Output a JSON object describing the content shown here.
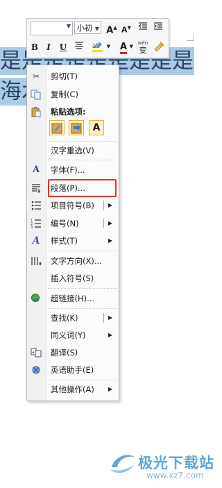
{
  "document": {
    "line1": "是是是是是是是是是",
    "line2": "海水"
  },
  "mini_toolbar": {
    "font_name": "",
    "font_size": "小初",
    "grow_font_label": "A",
    "shrink_font_label": "A",
    "bold_label": "B",
    "italic_label": "I",
    "underline_label": "U",
    "font_color_label": "A",
    "phonetic_label": "wén",
    "phonetic_char": "变"
  },
  "context_menu": {
    "items": [
      {
        "label": "剪切(T)",
        "icon": "scissors-icon"
      },
      {
        "label": "复制(C)",
        "icon": "copy-icon"
      },
      {
        "label": "粘贴选项:",
        "icon": "clipboard-icon"
      },
      {
        "label": "汉字重选(V)",
        "icon": ""
      },
      {
        "label": "字体(F)...",
        "icon": "font-icon"
      },
      {
        "label": "段落(P)...",
        "icon": "paragraph-icon"
      },
      {
        "label": "项目符号(B)",
        "icon": "bullets-icon"
      },
      {
        "label": "编号(N)",
        "icon": "numbering-icon"
      },
      {
        "label": "样式(T)",
        "icon": "styles-icon"
      },
      {
        "label": "文字方向(X)...",
        "icon": "text-direction-icon"
      },
      {
        "label": "插入符号(S)",
        "icon": ""
      },
      {
        "label": "超链接(H)...",
        "icon": "hyperlink-icon"
      },
      {
        "label": "查找(K)",
        "icon": ""
      },
      {
        "label": "同义词(Y)",
        "icon": ""
      },
      {
        "label": "翻译(S)",
        "icon": "translate-icon"
      },
      {
        "label": "英语助手(E)",
        "icon": "english-assistant-icon"
      },
      {
        "label": "其他操作(A)",
        "icon": ""
      }
    ],
    "paste_options": [
      "keep-source-formatting",
      "merge-formatting",
      "keep-text-only"
    ],
    "paste_text_only_label": "A"
  },
  "watermark": {
    "title": "极光下载站",
    "url": "www.xz7.com"
  },
  "colors": {
    "selection": "#a9cbe8",
    "highlight_border": "#e0352b",
    "font_color": "#e02020",
    "watermark": "#5ea6d6"
  }
}
